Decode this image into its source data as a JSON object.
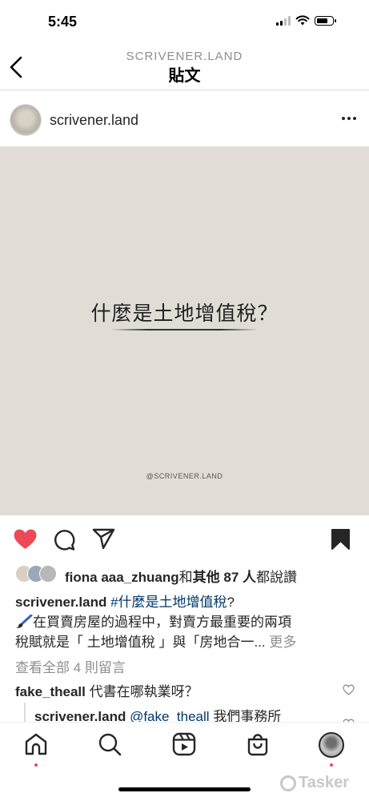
{
  "status_bar": {
    "time": "5:45"
  },
  "header": {
    "account": "SCRIVENER.LAND",
    "title": "貼文"
  },
  "post": {
    "username": "scrivener.land",
    "image": {
      "title": "什麼是土地增值稅？",
      "watermark": "@SCRIVENER.LAND"
    },
    "liked": true,
    "saved": true,
    "likes": {
      "first_user": "fiona aaa_zhuang",
      "connector": "和",
      "others": "其他 87 人",
      "suffix": "都說讚"
    },
    "caption": {
      "username": "scrivener.land",
      "hashtag": "#什麼是土地增值稅",
      "after_hashtag": "?",
      "line2": "在買賣房屋的過程中，對賣方最重要的兩項",
      "line3": "稅賦就是「 土地增值稅 」與「房地合一...",
      "more": "更多"
    },
    "view_comments": "查看全部 4 則留言",
    "comments": [
      {
        "username": "fake_theall",
        "text": "代書在哪執業呀？"
      },
      {
        "username": "scrivener.land",
        "mention": "@fake_theall",
        "text": "我們事務所"
      }
    ]
  },
  "nav": {
    "items": [
      "home-icon",
      "search-icon",
      "reels-icon",
      "shop-icon",
      "profile-avatar"
    ]
  },
  "watermark": "Tasker",
  "colors": {
    "like": "#ed4956",
    "link": "#00376b",
    "muted": "#8e8e8e",
    "image_bg": "#e1ddd6"
  }
}
